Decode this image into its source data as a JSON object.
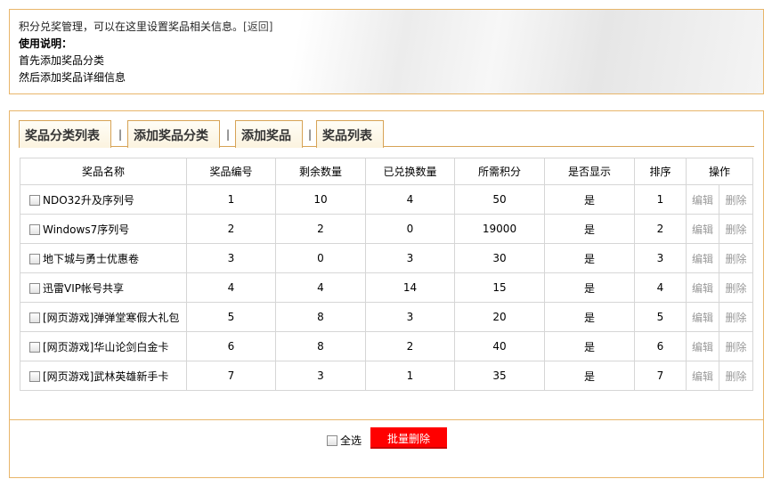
{
  "header": {
    "intro": "积分兑奖管理，可以在这里设置奖品相关信息。",
    "back_link": "[返回]",
    "usage_title": "使用说明：",
    "usage_lines": [
      "首先添加奖品分类",
      "然后添加奖品详细信息"
    ]
  },
  "tabs": [
    {
      "label": "奖品分类列表"
    },
    {
      "label": "添加奖品分类"
    },
    {
      "label": "添加奖品"
    },
    {
      "label": "奖品列表"
    }
  ],
  "tab_separator": "|",
  "table": {
    "columns": [
      "奖品名称",
      "奖品编号",
      "剩余数量",
      "已兑换数量",
      "所需积分",
      "是否显示",
      "排序",
      "操作"
    ],
    "edit_label": "编辑",
    "delete_label": "删除",
    "rows": [
      {
        "name": "NDO32升及序列号",
        "id": "1",
        "remaining": "10",
        "redeemed": "4",
        "points": "50",
        "shown": "是",
        "order": "1"
      },
      {
        "name": "Windows7序列号",
        "id": "2",
        "remaining": "2",
        "redeemed": "0",
        "points": "19000",
        "shown": "是",
        "order": "2"
      },
      {
        "name": "地下城与勇士优惠卷",
        "id": "3",
        "remaining": "0",
        "redeemed": "3",
        "points": "30",
        "shown": "是",
        "order": "3"
      },
      {
        "name": "迅雷VIP帐号共享",
        "id": "4",
        "remaining": "4",
        "redeemed": "14",
        "points": "15",
        "shown": "是",
        "order": "4"
      },
      {
        "name": "[网页游戏]弹弹堂寒假大礼包",
        "id": "5",
        "remaining": "8",
        "redeemed": "3",
        "points": "20",
        "shown": "是",
        "order": "5"
      },
      {
        "name": "[网页游戏]华山论剑白金卡",
        "id": "6",
        "remaining": "8",
        "redeemed": "2",
        "points": "40",
        "shown": "是",
        "order": "6"
      },
      {
        "name": "[网页游戏]武林英雄新手卡",
        "id": "7",
        "remaining": "3",
        "redeemed": "1",
        "points": "35",
        "shown": "是",
        "order": "7"
      }
    ]
  },
  "footer": {
    "select_all_label": "全选",
    "batch_delete_label": "批量删除"
  },
  "colors": {
    "border_accent": "#e8b66a",
    "batch_delete_bg": "#ff0000"
  }
}
